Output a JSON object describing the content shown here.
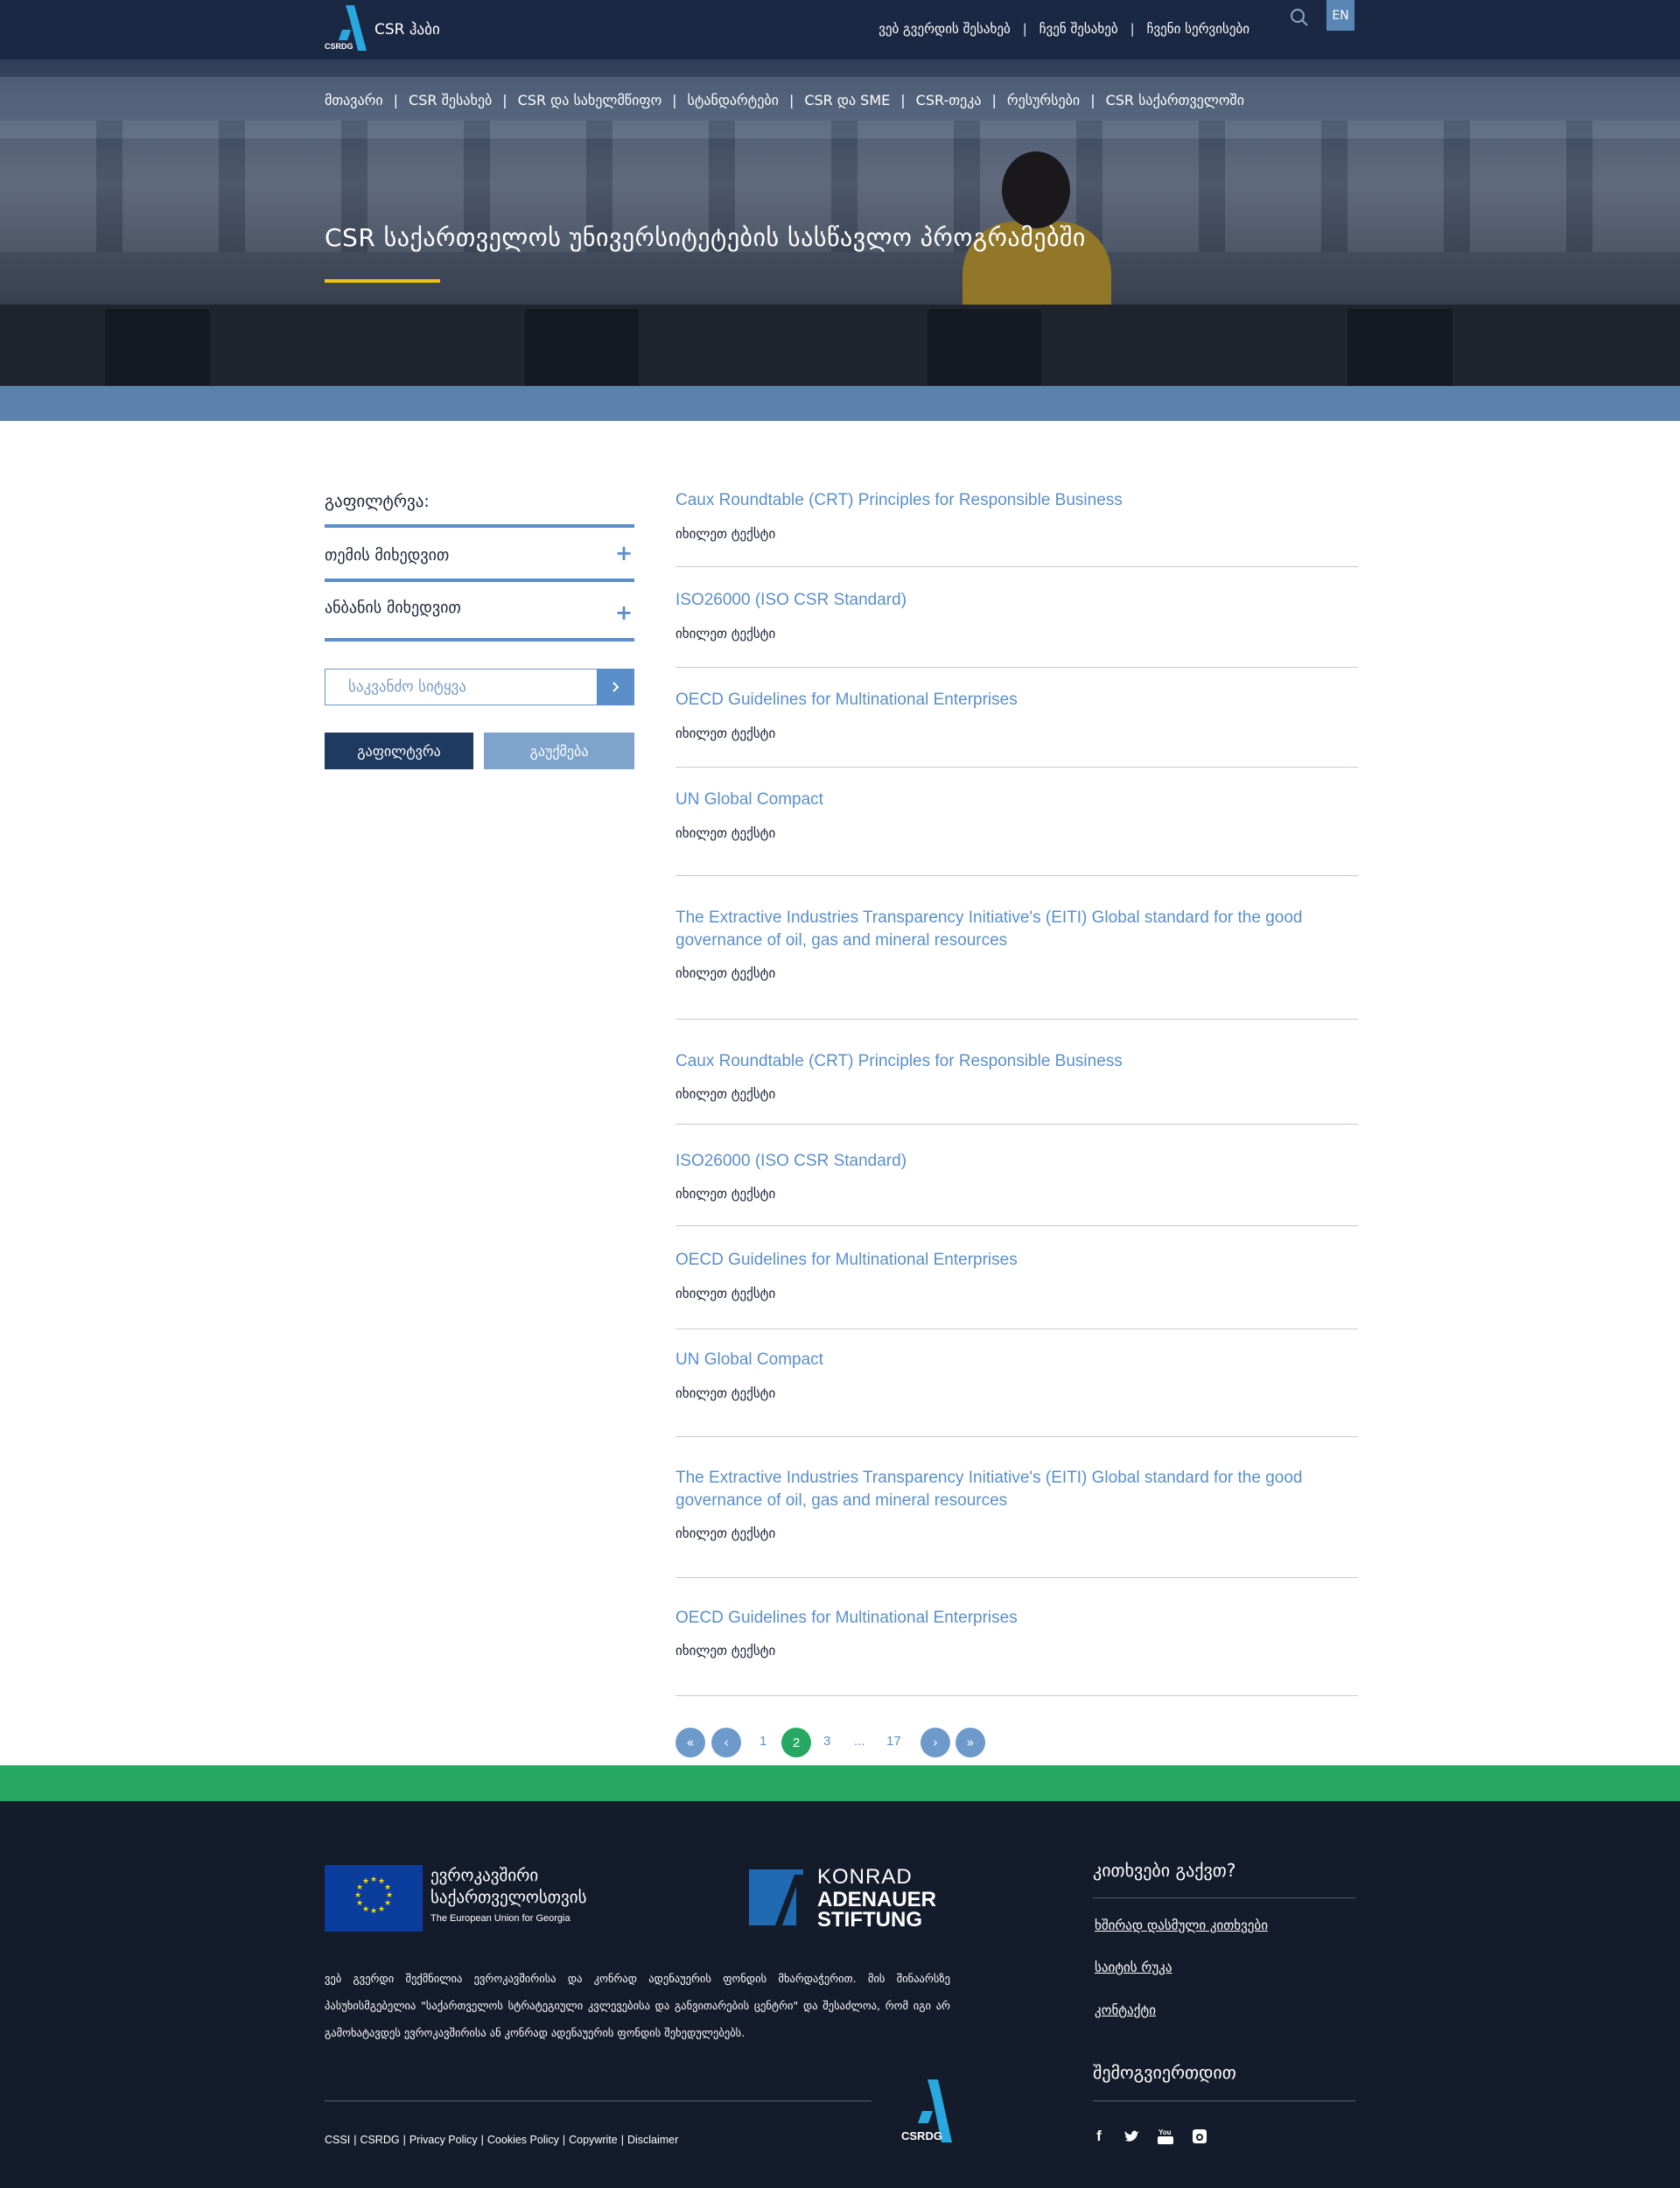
{
  "header": {
    "logo_text": "CSR ჰაბი",
    "logo_sub": "CSRDG",
    "top_nav": [
      "ვებ გვერდის შესახებ",
      "ჩვენ შესახებ",
      "ჩვენი სერვისები"
    ],
    "lang": "EN"
  },
  "main_nav": [
    "მთავარი",
    "CSR შესახებ",
    "CSR და სახელმწიფო",
    "სტანდარტები",
    "CSR და SME",
    "CSR-თეკა",
    "რესურსები",
    "CSR საქართველოში"
  ],
  "hero": {
    "title": "CSR საქართველოს უნივერსიტეტების სასწავლო პროგრამებში"
  },
  "sidebar": {
    "filter_title": "გაფილტრვა:",
    "accordion": [
      {
        "label": "თემის მიხედვით"
      },
      {
        "label": "ანბანის მიხედვით"
      }
    ],
    "search_placeholder": "საკვანძო სიტყვა",
    "filter_button": "გაფილტვრა",
    "cancel_button": "გაუქმება"
  },
  "items": [
    {
      "title": "Caux Roundtable (CRT) Principles for Responsible Business",
      "desc": "იხილეთ ტექსტი"
    },
    {
      "title": "ISO26000 (ISO CSR Standard)",
      "desc": "იხილეთ ტექსტი"
    },
    {
      "title": "OECD Guidelines for Multinational Enterprises",
      "desc": "იხილეთ ტექსტი"
    },
    {
      "title": "UN Global Compact",
      "desc": "იხილეთ ტექსტი"
    },
    {
      "title": "The Extractive Industries Transparency Initiative's (EITI) Global standard for the good governance of oil, gas and mineral resources",
      "desc": "იხილეთ ტექსტი"
    },
    {
      "title": "Caux Roundtable (CRT) Principles for Responsible Business",
      "desc": "იხილეთ ტექსტი"
    },
    {
      "title": "ISO26000 (ISO CSR Standard)",
      "desc": "იხილეთ ტექსტი"
    },
    {
      "title": "OECD Guidelines for Multinational Enterprises",
      "desc": "იხილეთ ტექსტი"
    },
    {
      "title": "UN Global Compact",
      "desc": "იხილეთ ტექსტი"
    },
    {
      "title": "The Extractive Industries Transparency Initiative's (EITI) Global standard for the good governance of oil, gas and mineral resources",
      "desc": "იხილეთ ტექსტი"
    },
    {
      "title": "OECD Guidelines for Multinational Enterprises",
      "desc": "იხილეთ ტექსტი"
    }
  ],
  "pagination": {
    "first": "«",
    "prev": "‹",
    "next": "›",
    "last": "»",
    "pages": [
      "1",
      "2",
      "3",
      "...",
      "17"
    ],
    "current": "2"
  },
  "footer": {
    "eu": {
      "line1": "ევროკავშირი",
      "line2": "საქართველოსთვის",
      "line3": "The European Union for Georgia"
    },
    "kas": {
      "line1": "KONRAD",
      "line2": "ADENAUER",
      "line3": "STIFTUNG"
    },
    "disclaimer": "ვებ გვერდი შექმნილია ევროკავშირისა და კონრად ადენაუერის ფონდის მხარდაჭერით. მის შინაარსზე პასუხისმგებელია \"საქართველოს სტრატეგიული კვლევებისა და განვითარების ცენტრი\" და შესაძლოა, რომ იგი არ გამოხატავდეს ევროკავშირისა ან კონრად ადენაუერის ფონდის შეხედულებებს.",
    "links": [
      "CSSI",
      "CSRDG",
      "Privacy Policy",
      "Cookies Policy",
      "Copywrite",
      "Disclaimer"
    ],
    "logo_text": "CSRDG",
    "questions_title": "კითხვები გაქვთ?",
    "question_links": [
      "ხშირად დასმული კითხვები",
      "საიტის რუკა",
      "კონტაქტი"
    ],
    "join_title": "შემოგვიერთდით",
    "social": [
      "facebook-icon",
      "twitter-icon",
      "youtube-icon",
      "instagram-icon"
    ]
  },
  "colors": {
    "navy": "#1b2844",
    "accent_blue": "#5b8fc9",
    "green": "#27a862",
    "yellow": "#f1c40f",
    "footer_bg": "#141c2b"
  }
}
